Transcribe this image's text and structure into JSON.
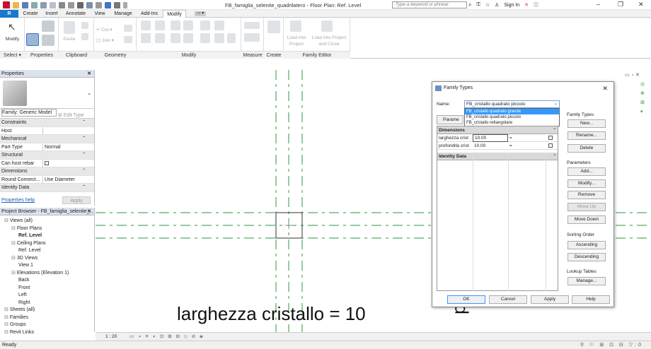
{
  "title_bar": {
    "title": "FB_famiglia_selenite_quadrilatero - Floor Plan: Ref. Level",
    "search_placeholder": "Type a keyword or phrase",
    "sign_in": "Sign In"
  },
  "tabs": [
    "Create",
    "Insert",
    "Annotate",
    "View",
    "Manage",
    "Add-Ins",
    "Modify"
  ],
  "active_tab": "Modify",
  "ribbon": {
    "modify_label": "Modify",
    "paste_label": "Paste",
    "cut_label": "Cut",
    "join_label": "Join",
    "load_into_project": "Load into Project",
    "load_into_project_close": "Load into Project and Close",
    "panels": {
      "select": "Select",
      "properties": "Properties",
      "clipboard": "Clipboard",
      "geometry": "Geometry",
      "modify": "Modify",
      "measure": "Measure",
      "create": "Create",
      "family_editor": "Family Editor"
    }
  },
  "properties_panel": {
    "title": "Properties",
    "type_selector": "Family: Generic Model",
    "edit_type": "Edit Type",
    "rows": [
      {
        "label": "Constraints",
        "value": "",
        "section": true
      },
      {
        "label": "Host",
        "value": "",
        "section": false
      },
      {
        "label": "Mechanical",
        "value": "",
        "section": true
      },
      {
        "label": "Part Type",
        "value": "Normal",
        "section": false
      },
      {
        "label": "Structural",
        "value": "",
        "section": true
      },
      {
        "label": "Can host rebar",
        "value": "",
        "section": false
      },
      {
        "label": "Dimensions",
        "value": "",
        "section": true
      },
      {
        "label": "Round Connect...",
        "value": "Use Diameter",
        "section": false
      },
      {
        "label": "Identity Data",
        "value": "",
        "section": true
      }
    ],
    "help_link": "Properties help",
    "apply": "Apply"
  },
  "project_browser": {
    "title": "Project Browser - FB_famiglia_selenite_...",
    "items": [
      {
        "label": "Views (all)",
        "level": 0,
        "bold": false
      },
      {
        "label": "Floor Plans",
        "level": 1,
        "bold": false
      },
      {
        "label": "Ref. Level",
        "level": 2,
        "bold": true
      },
      {
        "label": "Ceiling Plans",
        "level": 1,
        "bold": false
      },
      {
        "label": "Ref. Level",
        "level": 2,
        "bold": false
      },
      {
        "label": "3D Views",
        "level": 1,
        "bold": false
      },
      {
        "label": "View 1",
        "level": 2,
        "bold": false
      },
      {
        "label": "Elevations (Elevation 1)",
        "level": 1,
        "bold": false
      },
      {
        "label": "Back",
        "level": 2,
        "bold": false
      },
      {
        "label": "Front",
        "level": 2,
        "bold": false
      },
      {
        "label": "Left",
        "level": 2,
        "bold": false
      },
      {
        "label": "Right",
        "level": 2,
        "bold": false
      },
      {
        "label": "Sheets (all)",
        "level": 0,
        "bold": false
      },
      {
        "label": "Families",
        "level": 0,
        "bold": false
      },
      {
        "label": "Groups",
        "level": 0,
        "bold": false
      },
      {
        "label": "Revit Links",
        "level": 0,
        "bold": false
      }
    ]
  },
  "canvas": {
    "big_text": "larghezza cristallo = 10",
    "vertical_text": "pro"
  },
  "view_control_bar": {
    "scale": "1 : 20"
  },
  "status_bar": {
    "text": "Ready",
    "filter_count": ":0"
  },
  "dialog": {
    "title": "Family Types",
    "name_label": "Name:",
    "name_value": "FB_cristallo quadrato piccolo",
    "dropdown_options": [
      "FB_cristallo quadrato grande",
      "FB_cristallo quadrato piccolo",
      "FB_cristallo rettangolare"
    ],
    "dropdown_highlight_index": 0,
    "param_header": "Parame",
    "dimensions_header": "Dimensions",
    "params": [
      {
        "name": "larghezza crist",
        "value": "10.00",
        "formula": "="
      },
      {
        "name": "profondità crist",
        "value": "10.00",
        "formula": "="
      }
    ],
    "identity_header": "Identity Data",
    "family_types_label": "Family Types",
    "btn_new": "New...",
    "btn_rename": "Rename...",
    "btn_delete": "Delete",
    "parameters_label": "Parameters",
    "btn_add": "Add...",
    "btn_modify": "Modify...",
    "btn_remove": "Remove",
    "btn_move_up": "Move Up",
    "btn_move_down": "Move Down",
    "sorting_label": "Sorting Order",
    "btn_ascending": "Ascending",
    "btn_descending": "Descending",
    "lookup_label": "Lookup Tables",
    "btn_manage": "Manage...",
    "btn_ok": "OK",
    "btn_cancel": "Cancel",
    "btn_apply": "Apply",
    "btn_help": "Help"
  },
  "colors": {
    "accent": "#1979ca",
    "ref_plane": "#2a9a3a",
    "highlight": "#3399ff"
  }
}
